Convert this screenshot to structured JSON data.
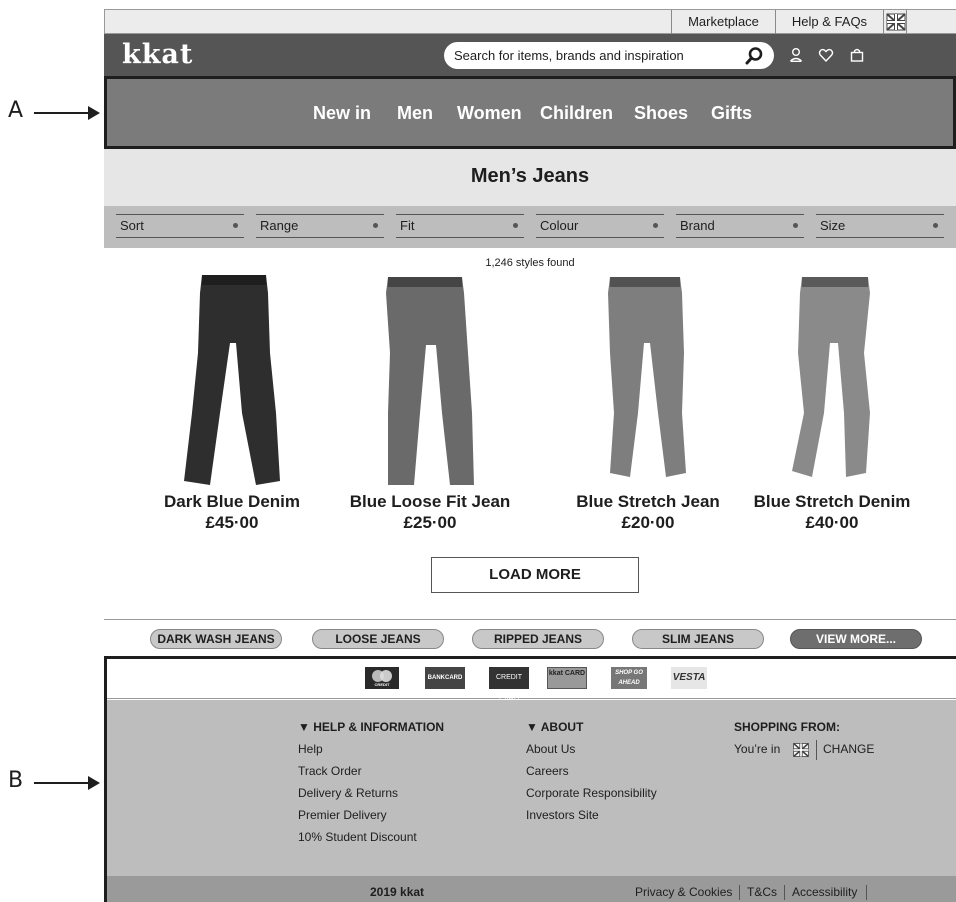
{
  "annotations": {
    "a": "A",
    "b": "B"
  },
  "topbar": {
    "marketplace": "Marketplace",
    "help": "Help & FAQs"
  },
  "header": {
    "logo": "kkat",
    "search_placeholder": "Search for items, brands and inspiration"
  },
  "nav": [
    "New in",
    "Men",
    "Women",
    "Children",
    "Shoes",
    "Gifts"
  ],
  "page_title": "Men’s Jeans",
  "filters": [
    "Sort",
    "Range",
    "Fit",
    "Colour",
    "Brand",
    "Size"
  ],
  "results_count": "1,246 styles found",
  "products": [
    {
      "name": "Dark Blue Denim",
      "price": "£45·00",
      "shade": "#2e2e2e"
    },
    {
      "name": "Blue Loose Fit Jean",
      "price": "£25·00",
      "shade": "#6a6a6a"
    },
    {
      "name": "Blue Stretch Jean",
      "price": "£20·00",
      "shade": "#7e7e7e"
    },
    {
      "name": "Blue Stretch Denim",
      "price": "£40·00",
      "shade": "#8a8a8a"
    }
  ],
  "load_more": "LOAD MORE",
  "chips": [
    "DARK WASH JEANS",
    "LOOSE JEANS",
    "RIPPED JEANS",
    "SLIM JEANS",
    "VIEW MORE..."
  ],
  "payments": [
    "CREDIT",
    "BANKCARD",
    "CREDIT CARD",
    "kkat CARD",
    "SHOP GO AHEAD",
    "VESTA"
  ],
  "footer": {
    "help_heading": "▼ HELP & INFORMATION",
    "help_links": [
      "Help",
      "Track Order",
      "Delivery & Returns",
      "Premier Delivery",
      "10% Student Discount"
    ],
    "about_heading": "▼ ABOUT",
    "about_links": [
      "About Us",
      "Careers",
      "Corporate Responsibility",
      "Investors Site"
    ],
    "shopping_heading": "SHOPPING FROM:",
    "youre_in": "You’re in",
    "change": "CHANGE",
    "copyright": "2019 kkat",
    "bottom_links": [
      "Privacy & Cookies",
      "T&Cs",
      "Accessibility"
    ]
  },
  "colors": {
    "header": "#555555",
    "nav": "#7b7b7b",
    "footer": "#bdbdbd",
    "chip_dark": "#6e6e6e"
  }
}
